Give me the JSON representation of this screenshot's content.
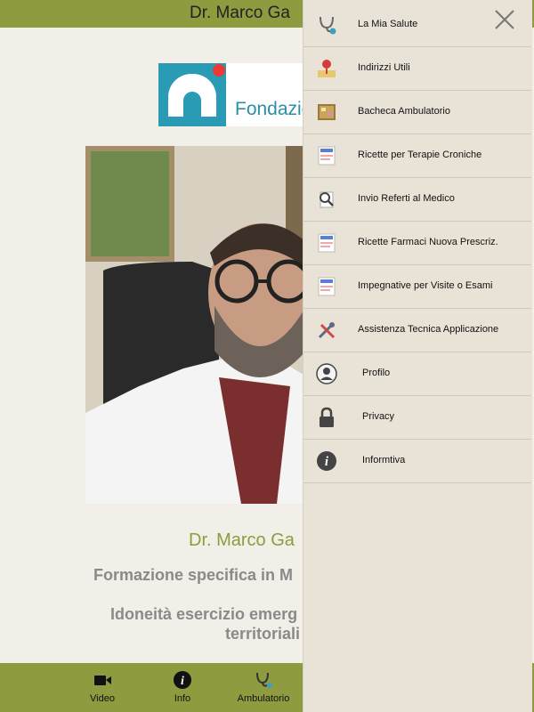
{
  "header": {
    "title": "Dr. Marco Ga"
  },
  "logo": {
    "text": "Fondazio"
  },
  "profile": {
    "name": "Dr. Marco Ga",
    "line1": "Formazione specifica in M",
    "line2": "Idoneità esercizio emerg",
    "line3": "territoriali"
  },
  "tabbar": {
    "tabs": [
      {
        "label": "Video",
        "icon": "video-camera-icon"
      },
      {
        "label": "Info",
        "icon": "info-icon"
      },
      {
        "label": "Ambulatorio",
        "icon": "stethoscope-icon"
      }
    ]
  },
  "menu": {
    "close_icon": "close-icon",
    "items": [
      {
        "label": "La Mia Salute",
        "icon": "stethoscope-icon"
      },
      {
        "label": "Indirizzi Utili",
        "icon": "map-pin-icon"
      },
      {
        "label": "Bacheca Ambulatorio",
        "icon": "notice-board-icon"
      },
      {
        "label": "Ricette per Terapie Croniche",
        "icon": "prescription-icon"
      },
      {
        "label": "Invio Referti al Medico",
        "icon": "magnifier-document-icon"
      },
      {
        "label": "Ricette Farmaci Nuova Prescriz.",
        "icon": "prescription-icon"
      },
      {
        "label": "Impegnative per Visite o Esami",
        "icon": "prescription-icon"
      },
      {
        "label": "Assistenza Tecnica Applicazione",
        "icon": "tools-icon"
      },
      {
        "label": "Profilo",
        "icon": "user-icon"
      },
      {
        "label": "Privacy",
        "icon": "lock-icon"
      },
      {
        "label": "Informtiva",
        "icon": "info-icon"
      }
    ]
  },
  "colors": {
    "accent": "#8e9b3e",
    "brand_teal": "#2a9bb5",
    "brand_red": "#e83a36",
    "menu_bg": "#e9e3d7"
  }
}
